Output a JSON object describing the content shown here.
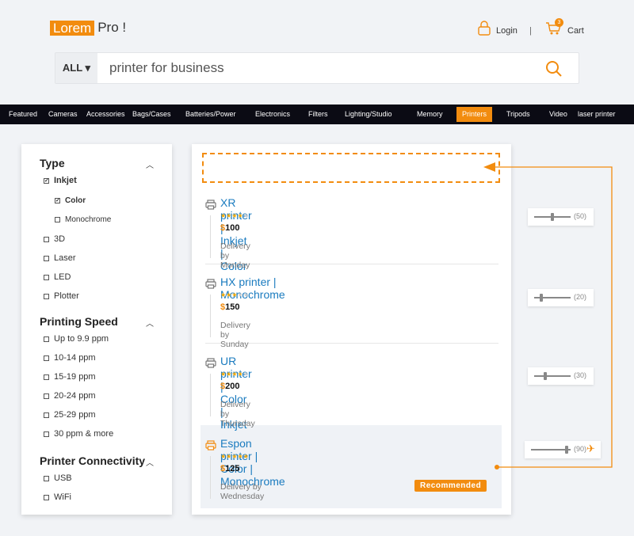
{
  "header": {
    "logo_highlight": "Lorem",
    "logo_rest": "Pro !",
    "login": "Login",
    "separator": "|",
    "cart": "Cart",
    "cart_count": "3"
  },
  "search": {
    "category": "ALL ▾",
    "value": "printer for business"
  },
  "nav": {
    "items": [
      "Featured",
      "Cameras",
      "Accessories",
      "Bags/Cases",
      "Batteries/Power",
      "Electronics",
      "Filters",
      "Lighting/Studio",
      "Memory",
      "Printers",
      "Tripods",
      "Video",
      "laser printer"
    ],
    "active": "Printers"
  },
  "filters": {
    "type_title": "Type",
    "type": [
      {
        "label": "Inkjet",
        "checked": true
      },
      {
        "label": "Color",
        "checked": true
      },
      {
        "label": "Monochrome",
        "checked": false
      },
      {
        "label": "3D",
        "checked": false
      },
      {
        "label": "Laser",
        "checked": false
      },
      {
        "label": "LED",
        "checked": false
      },
      {
        "label": "Plotter",
        "checked": false
      }
    ],
    "speed_title": "Printing Speed",
    "speed": [
      "Up to 9.9 ppm",
      "10-14 ppm",
      "15-19 ppm",
      "20-24 ppm",
      "25-29 ppm",
      "30 ppm & more"
    ],
    "conn_title": "Printer Connectivity",
    "conn": [
      "USB",
      "WiFi"
    ]
  },
  "products": [
    {
      "title": "XR printer | Inkjet | Color",
      "rating": 4,
      "currency": "$",
      "price": "100",
      "delivery": "Delivery by Monday",
      "slider": 50,
      "slider_label": "(50)"
    },
    {
      "title": "HX printer | Monochrome",
      "rating": 3,
      "currency": "$",
      "price": "150",
      "delivery": "Delivery by Sunday",
      "slider": 20,
      "slider_label": "(20)"
    },
    {
      "title": "UR printer | Color | Inkjet",
      "rating": 4,
      "currency": "$",
      "price": "200",
      "delivery": "Delivery by Thursday",
      "slider": 30,
      "slider_label": "(30)"
    },
    {
      "title": "Espon printer | Color | Monochrome",
      "rating": 5,
      "currency": "$",
      "price": "125",
      "delivery": "Delivery by Wednesday",
      "slider": 90,
      "slider_label": "(90)",
      "badge": "Recommended",
      "highlighted": true
    }
  ],
  "colors": {
    "accent": "#f28c0f",
    "link": "#1a7bbf",
    "nav_bg": "#0b0b14"
  }
}
